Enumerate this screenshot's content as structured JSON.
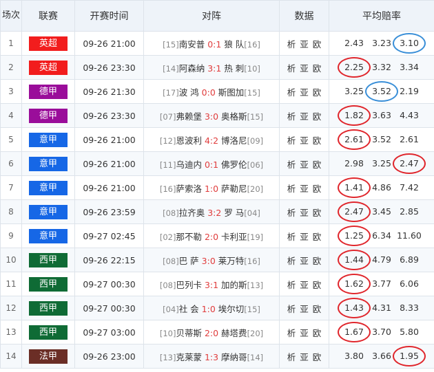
{
  "header": {
    "no": "场次",
    "league": "联赛",
    "time": "开赛时间",
    "match": "对阵",
    "data": "数据",
    "odds": "平均赔率"
  },
  "data_links": [
    "析",
    "亚",
    "欧"
  ],
  "colors": {
    "英超": "#f21d1d",
    "德甲": "#9a0d9a",
    "意甲": "#1667e6",
    "西甲": "#0f6b35",
    "法甲": "#6b2e26",
    "circle_red": "#e0262c",
    "circle_blue": "#3a8fd8"
  },
  "rows": [
    {
      "no": "1",
      "league": "英超",
      "time": "09-26 21:00",
      "home_rank": "[15]",
      "home": "南安普",
      "score": "0:1",
      "away": "狼 队",
      "away_rank": "[16]",
      "odds": [
        "2.43",
        "3.23",
        "3.10"
      ],
      "circle": [
        null,
        null,
        "blue"
      ]
    },
    {
      "no": "2",
      "league": "英超",
      "time": "09-26 23:30",
      "home_rank": "[14]",
      "home": "阿森纳",
      "score": "3:1",
      "away": "热 刺",
      "away_rank": "[10]",
      "odds": [
        "2.25",
        "3.32",
        "3.34"
      ],
      "circle": [
        "red",
        null,
        null
      ]
    },
    {
      "no": "3",
      "league": "德甲",
      "time": "09-26 21:30",
      "home_rank": "[17]",
      "home": "波 鸿",
      "score": "0:0",
      "away": "斯图加",
      "away_rank": "[15]",
      "odds": [
        "3.25",
        "3.52",
        "2.19"
      ],
      "circle": [
        null,
        "blue",
        null
      ]
    },
    {
      "no": "4",
      "league": "德甲",
      "time": "09-26 23:30",
      "home_rank": "[07]",
      "home": "弗赖堡",
      "score": "3:0",
      "away": "奥格斯",
      "away_rank": "[15]",
      "odds": [
        "1.82",
        "3.63",
        "4.43"
      ],
      "circle": [
        "red",
        null,
        null
      ]
    },
    {
      "no": "5",
      "league": "意甲",
      "time": "09-26 21:00",
      "home_rank": "[12]",
      "home": "恩波利",
      "score": "4:2",
      "away": "博洛尼",
      "away_rank": "[09]",
      "odds": [
        "2.61",
        "3.52",
        "2.61"
      ],
      "circle": [
        "red",
        null,
        null
      ]
    },
    {
      "no": "6",
      "league": "意甲",
      "time": "09-26 21:00",
      "home_rank": "[11]",
      "home": "乌迪内",
      "score": "0:1",
      "away": "佛罗伦",
      "away_rank": "[06]",
      "odds": [
        "2.98",
        "3.25",
        "2.47"
      ],
      "circle": [
        null,
        null,
        "red"
      ]
    },
    {
      "no": "7",
      "league": "意甲",
      "time": "09-26 21:00",
      "home_rank": "[16]",
      "home": "萨索洛",
      "score": "1:0",
      "away": "萨勒尼",
      "away_rank": "[20]",
      "odds": [
        "1.41",
        "4.86",
        "7.42"
      ],
      "circle": [
        "red",
        null,
        null
      ]
    },
    {
      "no": "8",
      "league": "意甲",
      "time": "09-26 23:59",
      "home_rank": "[08]",
      "home": "拉齐奥",
      "score": "3:2",
      "away": "罗 马",
      "away_rank": "[04]",
      "odds": [
        "2.47",
        "3.45",
        "2.85"
      ],
      "circle": [
        "red",
        null,
        null
      ]
    },
    {
      "no": "9",
      "league": "意甲",
      "time": "09-27 02:45",
      "home_rank": "[02]",
      "home": "那不勒",
      "score": "2:0",
      "away": "卡利亚",
      "away_rank": "[19]",
      "odds": [
        "1.25",
        "6.34",
        "11.60"
      ],
      "circle": [
        "red",
        null,
        null
      ]
    },
    {
      "no": "10",
      "league": "西甲",
      "time": "09-26 22:15",
      "home_rank": "[08]",
      "home": "巴 萨",
      "score": "3:0",
      "away": "莱万特",
      "away_rank": "[16]",
      "odds": [
        "1.44",
        "4.79",
        "6.89"
      ],
      "circle": [
        "red",
        null,
        null
      ]
    },
    {
      "no": "11",
      "league": "西甲",
      "time": "09-27 00:30",
      "home_rank": "[08]",
      "home": "巴列卡",
      "score": "3:1",
      "away": "加的斯",
      "away_rank": "[13]",
      "odds": [
        "1.62",
        "3.77",
        "6.06"
      ],
      "circle": [
        "red",
        null,
        null
      ]
    },
    {
      "no": "12",
      "league": "西甲",
      "time": "09-27 00:30",
      "home_rank": "[04]",
      "home": "社 会",
      "score": "1:0",
      "away": "埃尔切",
      "away_rank": "[15]",
      "odds": [
        "1.43",
        "4.31",
        "8.33"
      ],
      "circle": [
        "red",
        null,
        null
      ]
    },
    {
      "no": "13",
      "league": "西甲",
      "time": "09-27 03:00",
      "home_rank": "[10]",
      "home": "贝蒂斯",
      "score": "2:0",
      "away": "赫塔费",
      "away_rank": "[20]",
      "odds": [
        "1.67",
        "3.70",
        "5.80"
      ],
      "circle": [
        "red",
        null,
        null
      ]
    },
    {
      "no": "14",
      "league": "法甲",
      "time": "09-26 23:00",
      "home_rank": "[13]",
      "home": "克莱蒙",
      "score": "1:3",
      "away": "摩纳哥",
      "away_rank": "[14]",
      "odds": [
        "3.80",
        "3.66",
        "1.95"
      ],
      "circle": [
        null,
        null,
        "red"
      ]
    }
  ]
}
